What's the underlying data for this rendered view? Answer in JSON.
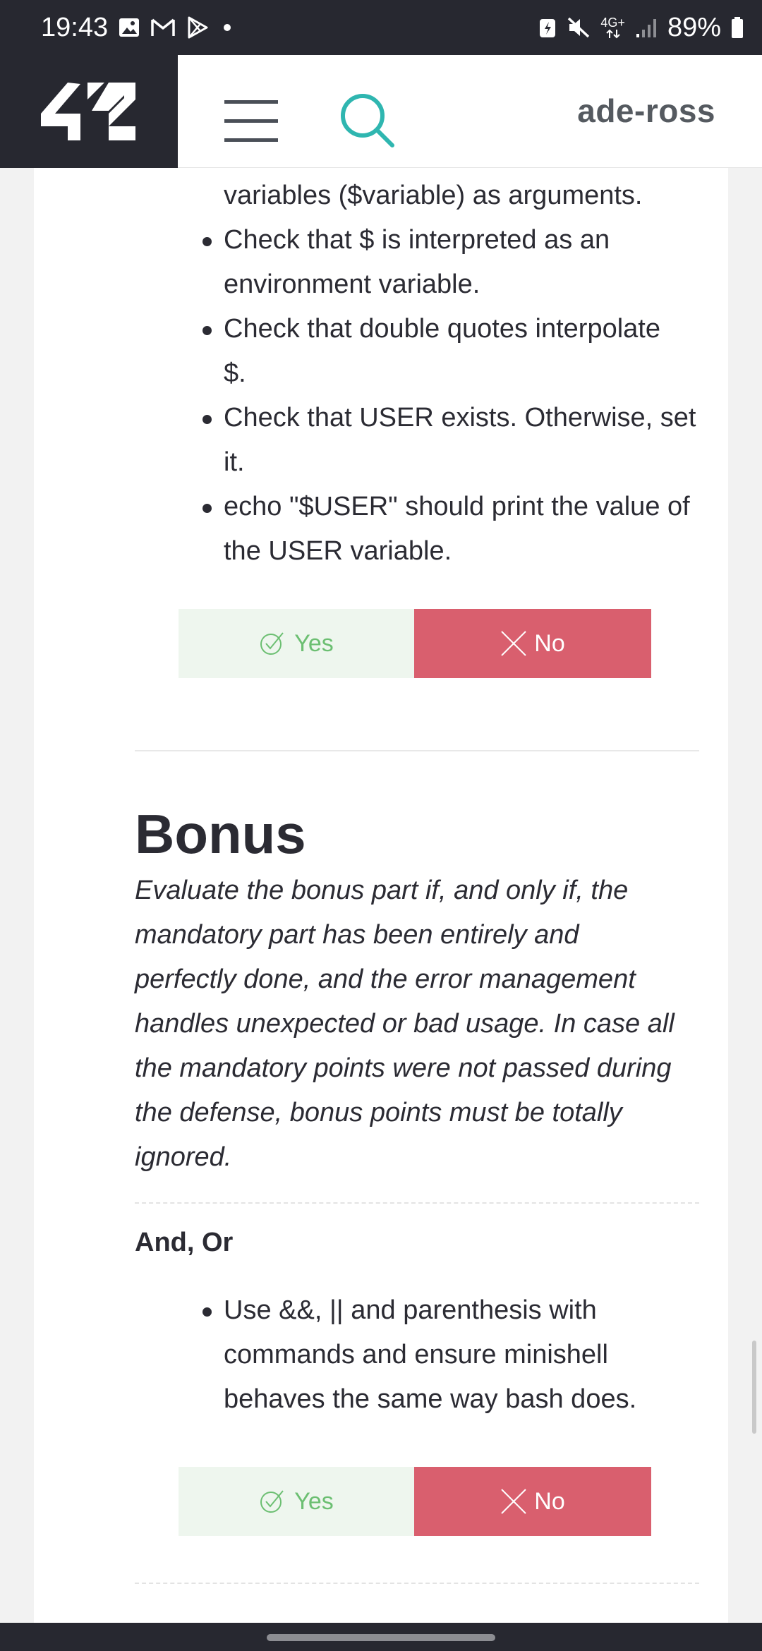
{
  "status_bar": {
    "time": "19:43",
    "network": "4G+",
    "battery": "89%",
    "icons": [
      "gallery-icon",
      "gmail-icon",
      "play-store-icon",
      "notification-dot",
      "battery-saver-icon",
      "mute-icon",
      "signal-icon",
      "battery-icon"
    ]
  },
  "header": {
    "logo": "42",
    "username": "ade-ross",
    "icons": [
      "menu-icon",
      "search-icon"
    ],
    "colors": {
      "bar": "#272830",
      "search_accent": "#2fb6b0"
    }
  },
  "section_1": {
    "bullets": [
      "variables ($variable) as arguments.",
      "Check that $ is interpreted as an",
      "environment variable.",
      "Check that double quotes interpolate",
      "$.",
      "Check that USER exists. Otherwise, set",
      "it.",
      "echo \"$USER\" should print the value of",
      "the USER variable."
    ],
    "yes_label": "Yes",
    "no_label": "No"
  },
  "bonus": {
    "title": "Bonus",
    "description_lines": [
      "Evaluate the bonus part if, and only if, the",
      "mandatory part has been entirely and",
      "perfectly done, and the error management",
      "handles unexpected or bad usage. In case all",
      "the mandatory points were not passed during",
      "the defense, bonus points must be totally",
      "ignored."
    ],
    "and_or": {
      "title": "And, Or",
      "bullets": [
        "Use &&, || and parenthesis with",
        "commands and ensure minishell",
        "behaves the same way bash does."
      ],
      "yes_label": "Yes",
      "no_label": "No"
    }
  },
  "colors": {
    "yes_bg": "#eef6ee",
    "yes_text": "#6cbf72",
    "no_bg": "#d95f6e",
    "no_text": "#ffffff"
  }
}
